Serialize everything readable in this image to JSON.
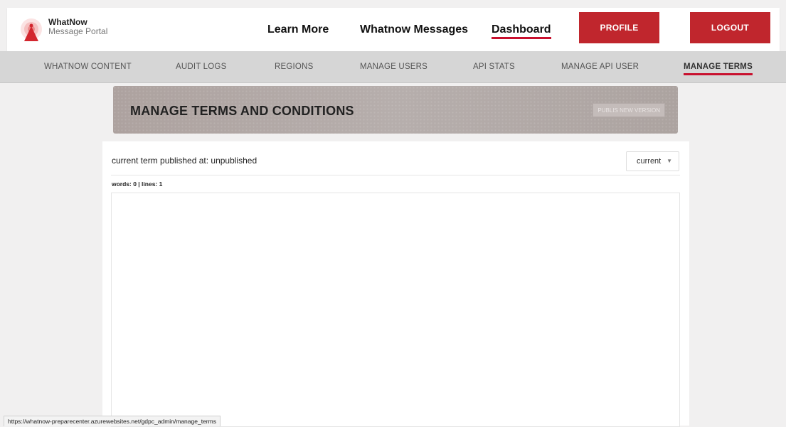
{
  "header": {
    "brand_name": "WhatNow",
    "brand_sub": "Message Portal",
    "links": {
      "learn_more": "Learn More",
      "whatnow_messages": "Whatnow Messages",
      "dashboard": "Dashboard"
    },
    "profile_label": "PROFILE",
    "logout_label": "LOGOUT"
  },
  "subnav": {
    "whatnow_content": "WHATNOW CONTENT",
    "audit_logs": "AUDIT LOGS",
    "regions": "REGIONS",
    "manage_users": "MANAGE USERS",
    "api_stats": "API STATS",
    "manage_api_user": "MANAGE API USER",
    "manage_terms": "MANAGE TERMS"
  },
  "banner": {
    "title": "MANAGE TERMS AND CONDITIONS",
    "publish_label": "PUBLIS NEW VERSION"
  },
  "content": {
    "term_status": "current term published at: unpublished",
    "version_select": "current",
    "word_count": "words: 0 | lines: 1",
    "editor_text": ""
  },
  "statusbar": {
    "url": "https://whatnow-preparecenter.azurewebsites.net/gdpc_admin/manage_terms"
  },
  "colors": {
    "accent_red": "#c0262d",
    "active_underline": "#c8102e",
    "subnav_bg": "#d6d6d6",
    "page_bg": "#f1f0f0"
  }
}
